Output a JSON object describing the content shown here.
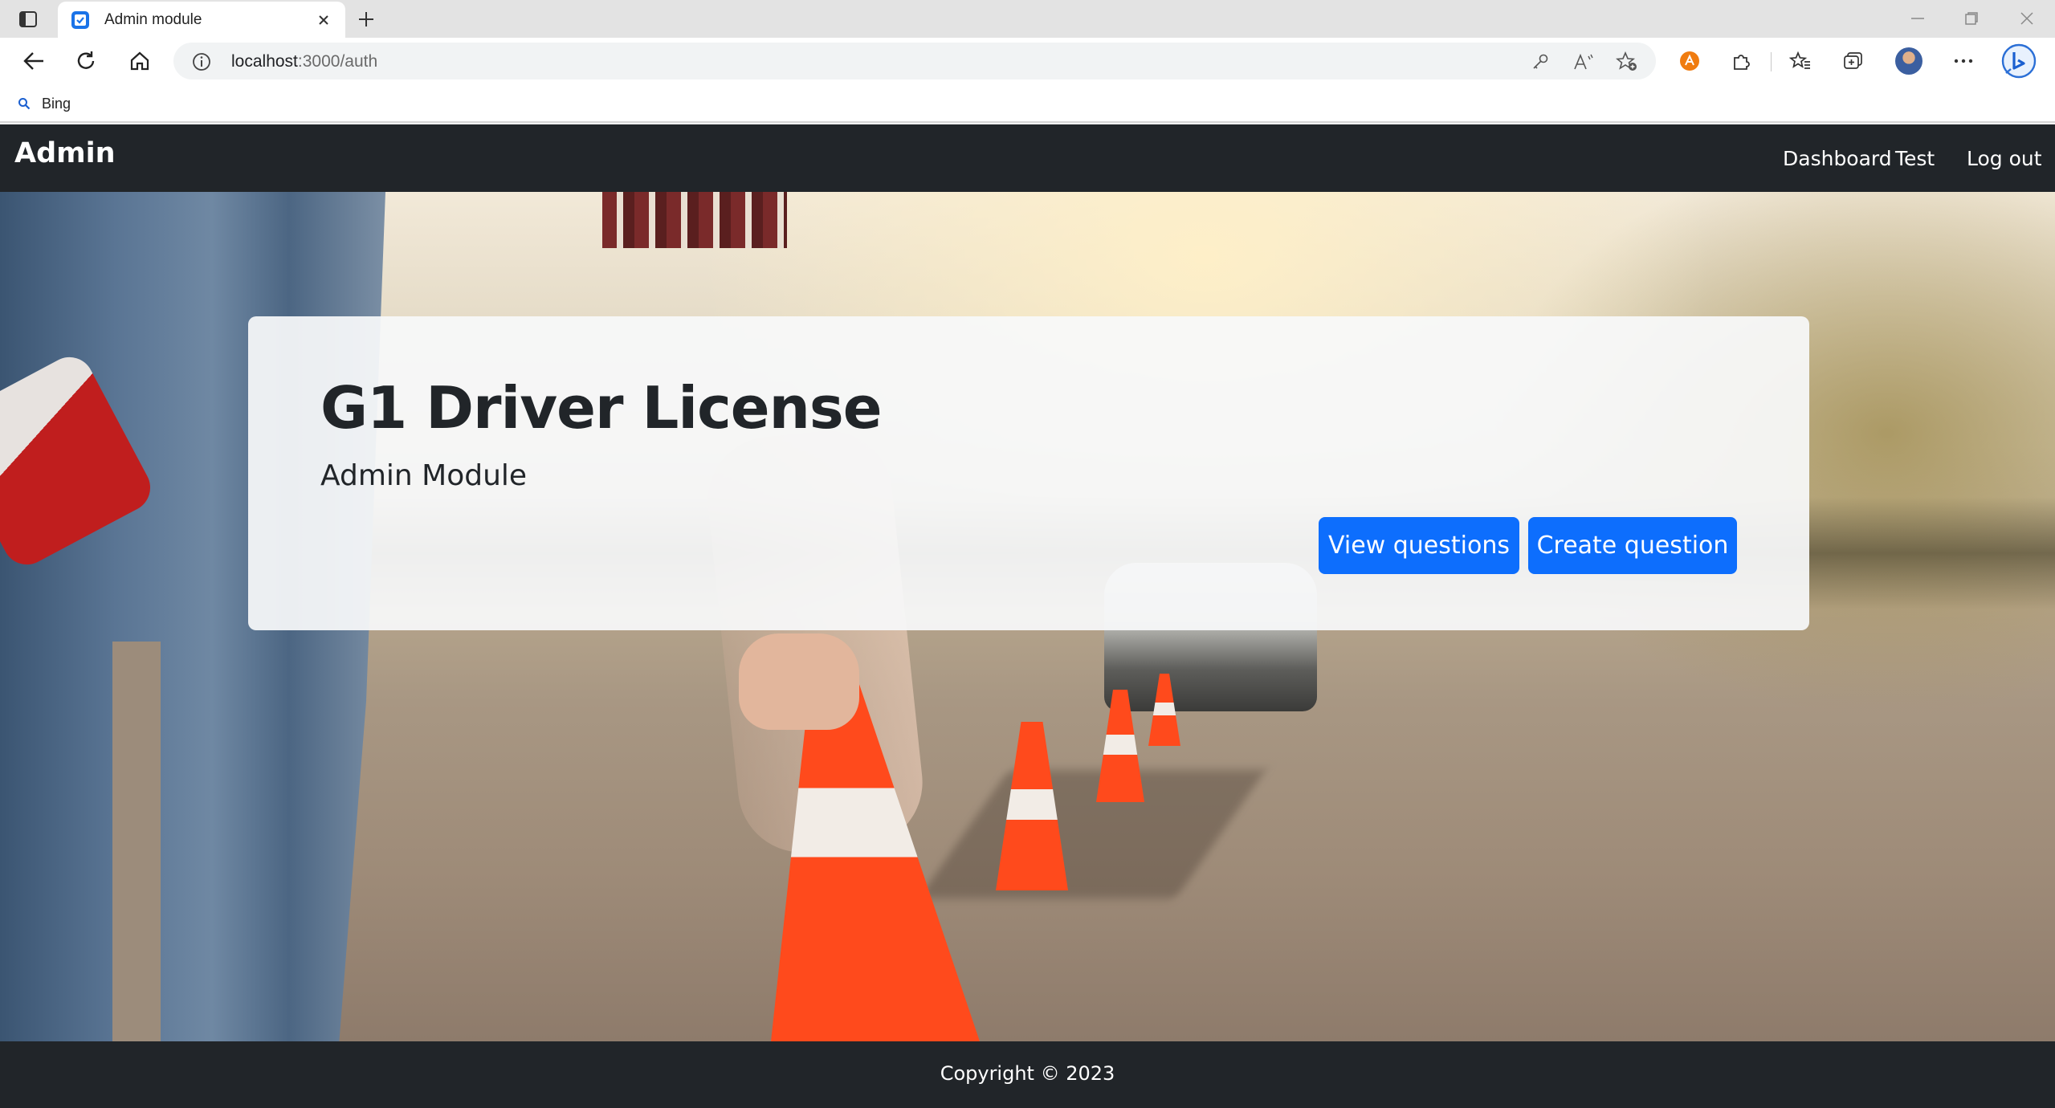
{
  "browser": {
    "tab": {
      "title": "Admin module"
    },
    "address": {
      "host": "localhost",
      "rest": ":3000/auth"
    },
    "favorites": [
      {
        "label": "Bing"
      }
    ]
  },
  "navbar": {
    "brand": "Admin",
    "links": [
      {
        "label": "Dashboard"
      },
      {
        "label": "Test"
      },
      {
        "label": "Log out"
      }
    ]
  },
  "hero": {
    "title": "G1 Driver License",
    "subtitle": "Admin Module",
    "buttons": [
      {
        "label": "View questions"
      },
      {
        "label": "Create question"
      }
    ]
  },
  "footer": {
    "text": "Copyright © 2023"
  },
  "colors": {
    "navbar_bg": "#212529",
    "primary": "#0d6efd",
    "panel_bg": "#f8f9fa"
  }
}
